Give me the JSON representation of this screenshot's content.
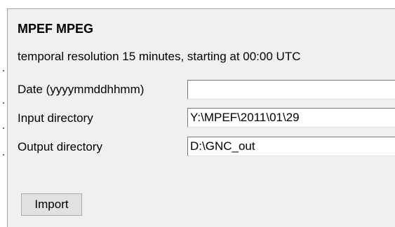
{
  "panel": {
    "title": "MPEF MPEG",
    "description": "temporal resolution 15 minutes, starting at 00:00 UTC"
  },
  "fields": [
    {
      "label": "Date (yyyymmddhhmm)",
      "value": ""
    },
    {
      "label": "Input directory",
      "value": "Y:\\MPEF\\2011\\01\\29"
    },
    {
      "label": "Output directory",
      "value": "D:\\GNC_out"
    }
  ],
  "buttons": {
    "import_label": "Import"
  },
  "colors": {
    "panel_bg": "#f0f0f0",
    "field_bg": "#ffffff",
    "button_bg": "#e1e1e1"
  }
}
